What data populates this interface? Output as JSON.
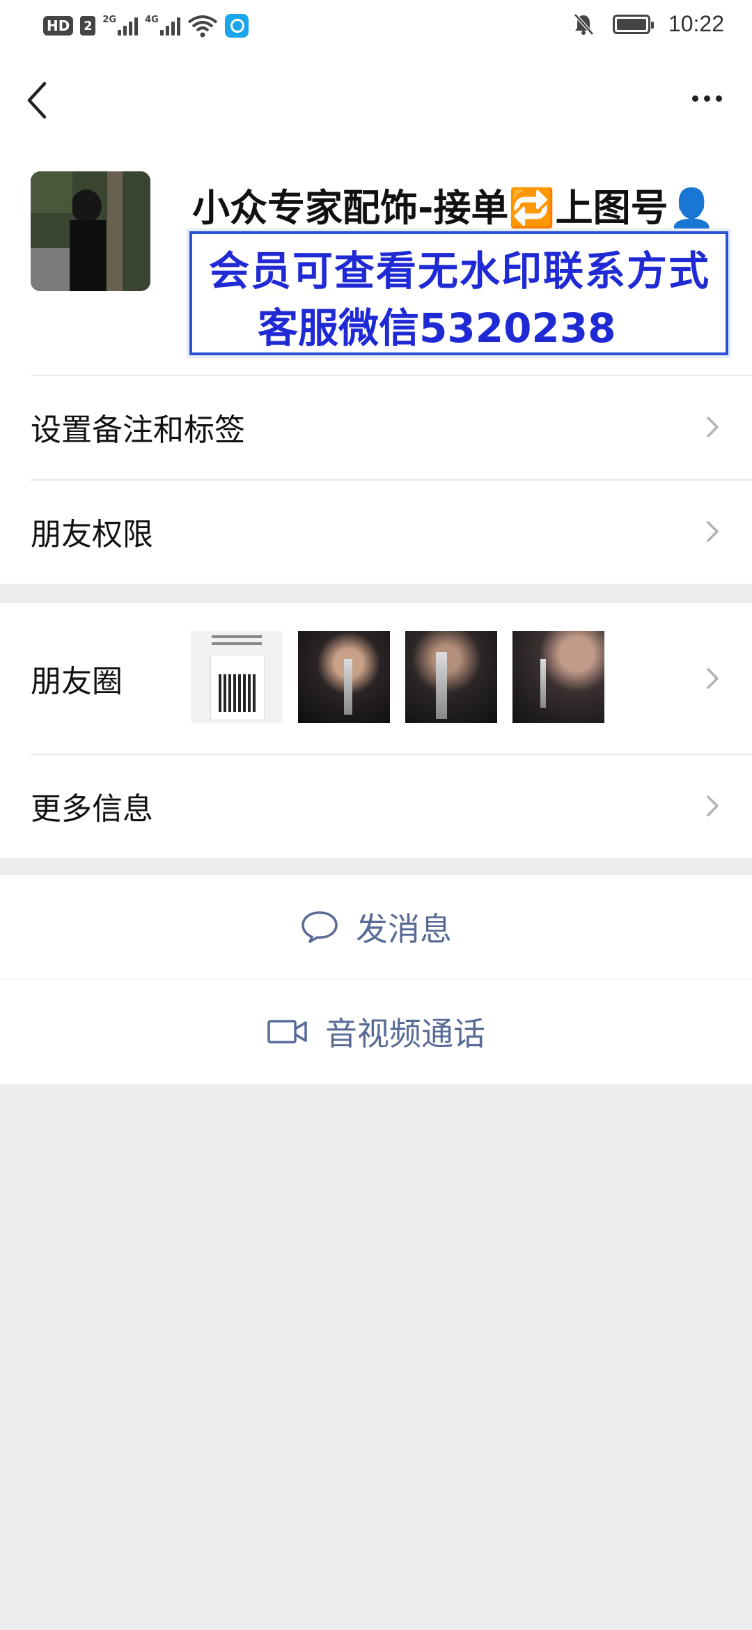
{
  "status_bar": {
    "hd": "HD",
    "sim": "2",
    "net1": "2G",
    "net2": "4G",
    "time": "10:22"
  },
  "profile": {
    "name": "小众专家配饰-接单🔁上图号👤",
    "watermark_line1": "会员可查看无水印联系方式",
    "watermark_line2": "客服微信5320238"
  },
  "menu": {
    "remark_tags": "设置备注和标签",
    "friend_permissions": "朋友权限",
    "moments": "朋友圈",
    "more_info": "更多信息"
  },
  "actions": {
    "message": "发消息",
    "call": "音视频通话"
  },
  "colors": {
    "link": "#576b95",
    "watermark": "#1f2ad4",
    "background": "#ededed"
  }
}
